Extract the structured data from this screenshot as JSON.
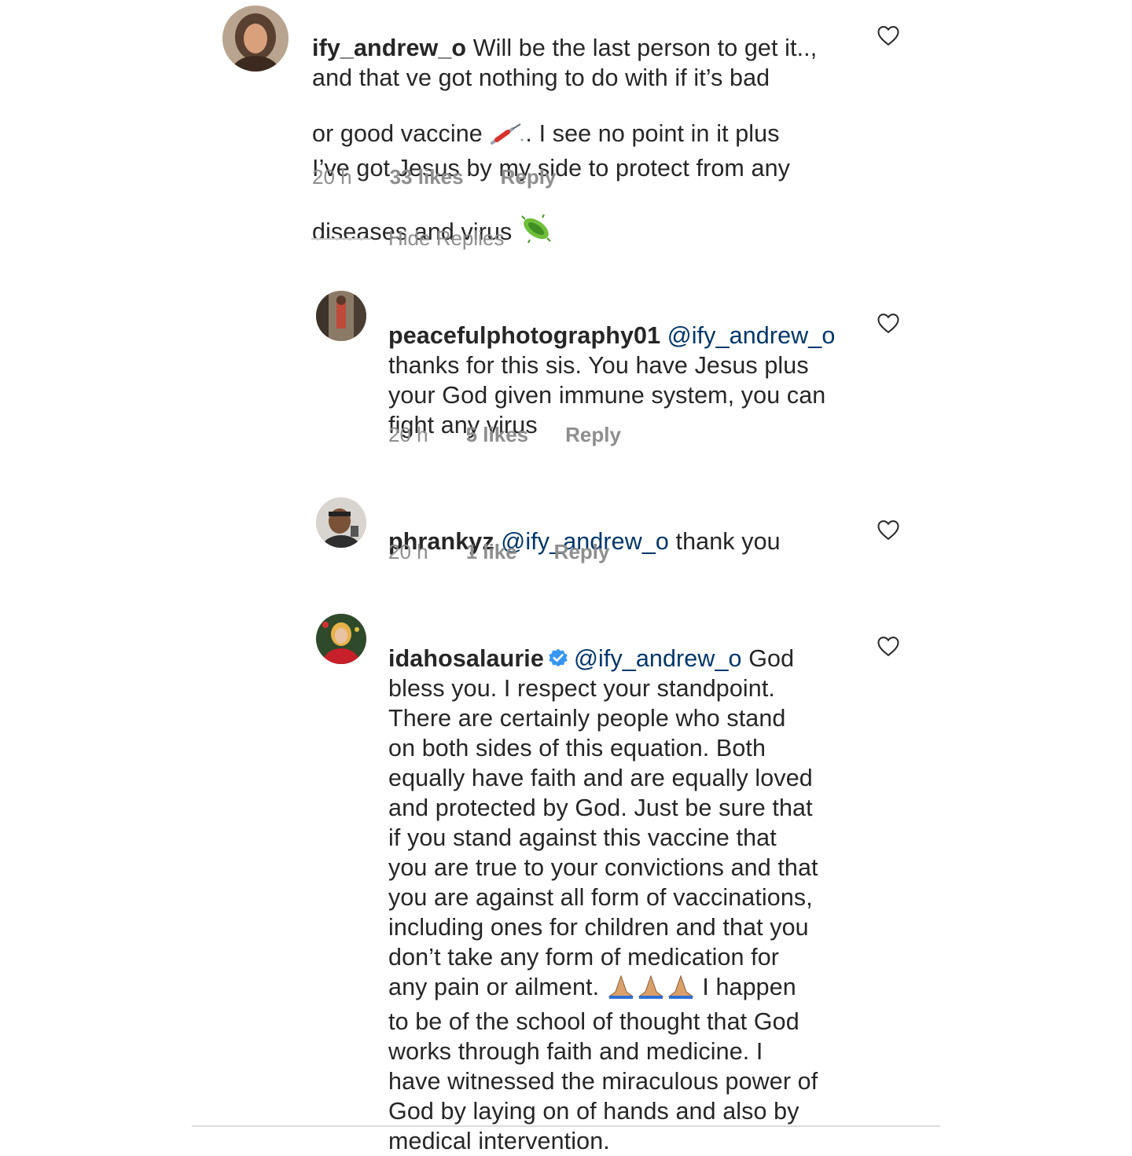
{
  "comments": [
    {
      "username": "ify_andrew_o",
      "text": "Will be the last person to get it..,\nand that ve got nothing to do with if it’s bad\nor good vaccine",
      "text_b": ". I see no point in it plus\nI’ve got Jesus by my side to protect from any\ndiseases and virus",
      "time": "20 h",
      "likes": "33 likes",
      "reply": "Reply"
    },
    {
      "username": "peacefulphotography01",
      "mention": "@ify_andrew_o",
      "text": "thanks for this sis. You have Jesus plus\nyour God given immune system, you can\nfight any virus",
      "time": "20 h",
      "likes": "5 likes",
      "reply": "Reply"
    },
    {
      "username": "phrankyz",
      "mention": "@ify_andrew_o",
      "text": "thank you",
      "time": "20 h",
      "likes": "1 like",
      "reply": "Reply"
    },
    {
      "username": "idahosalaurie",
      "mention": "@ify_andrew_o",
      "text_a": "God\nbless you. I respect your standpoint.\nThere are certainly people who stand\non both sides of this equation. Both\nequally have faith and are equally loved\nand protected by God. Just be sure that\nif you stand against this vaccine that\nyou are true to your convictions and that\nyou are against all form of vaccinations,\nincluding ones for children and that you\ndon’t take any form of medication for\nany pain or ailment.",
      "text_b": "I happen\nto be of the school of thought that God\nworks through faith and medicine. I\nhave witnessed the miraculous power of\nGod  by laying on of hands and also by\nmedical intervention."
    }
  ],
  "hide_replies": "Hide Replies",
  "icons": {
    "like": "heart-outline-icon",
    "verified": "verified-badge-icon",
    "syringe": "syringe-emoji",
    "microbe": "microbe-emoji",
    "pray": "folded-hands-emoji"
  },
  "colors": {
    "text": "#262626",
    "meta": "#8e8e8e",
    "mention": "#00376b",
    "verified": "#3897f0"
  }
}
